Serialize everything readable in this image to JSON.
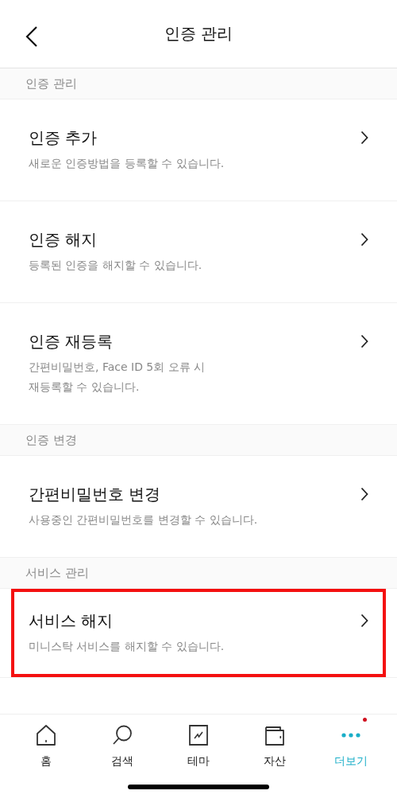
{
  "header": {
    "title": "인증 관리"
  },
  "sections": [
    {
      "title": "인증 관리",
      "items": [
        {
          "title": "인증 추가",
          "description": "새로운 인증방법을 등록할 수 있습니다.",
          "highlighted": false
        },
        {
          "title": "인증 해지",
          "description": "등록된 인증을 해지할 수 있습니다.",
          "highlighted": false
        },
        {
          "title": "인증 재등록",
          "description": "간편비밀번호, Face ID 5회 오류 시\n재등록할 수 있습니다.",
          "highlighted": false
        }
      ]
    },
    {
      "title": "인증 변경",
      "items": [
        {
          "title": "간편비밀번호 변경",
          "description": "사용중인 간편비밀번호를 변경할 수 있습니다.",
          "highlighted": false
        }
      ]
    },
    {
      "title": "서비스 관리",
      "items": [
        {
          "title": "서비스 해지",
          "description": "미니스탁 서비스를 해지할 수 있습니다.",
          "highlighted": true
        }
      ]
    }
  ],
  "tab_bar": [
    {
      "kind": "home",
      "label": "홈",
      "selected": false,
      "alert": false
    },
    {
      "kind": "search",
      "label": "검색",
      "selected": false,
      "alert": false
    },
    {
      "kind": "theme",
      "label": "테마",
      "selected": false,
      "alert": false
    },
    {
      "kind": "wallet",
      "label": "자산",
      "selected": false,
      "alert": false
    },
    {
      "kind": "more",
      "label": "더보기",
      "selected": true,
      "alert": true
    }
  ]
}
